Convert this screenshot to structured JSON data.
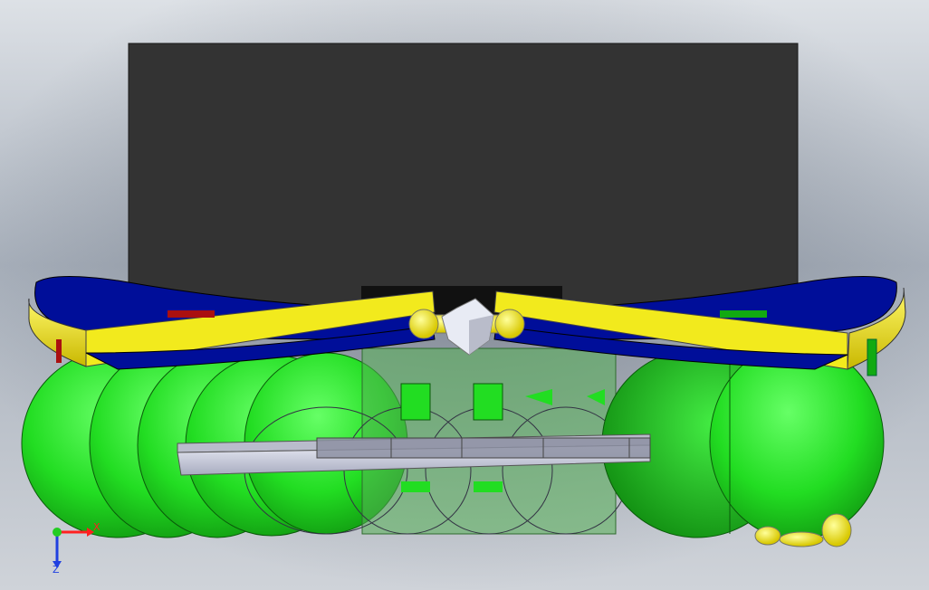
{
  "viewport": {
    "background_colors": {
      "top": "#d4d9e0",
      "mid": "#aab2bd",
      "bottom": "#c7ccd3"
    },
    "colors": {
      "backing_plate": "#333333",
      "body_green": "#22dd22",
      "wing_blue": "#000e99",
      "wing_yellow": "#f2ea1d",
      "deck_grey": "#c9cde0"
    }
  },
  "triad": {
    "x_label": "X",
    "z_label": "Z",
    "x_color": "#ff2020",
    "y_color": "#22cc22",
    "z_color": "#2040e0"
  }
}
